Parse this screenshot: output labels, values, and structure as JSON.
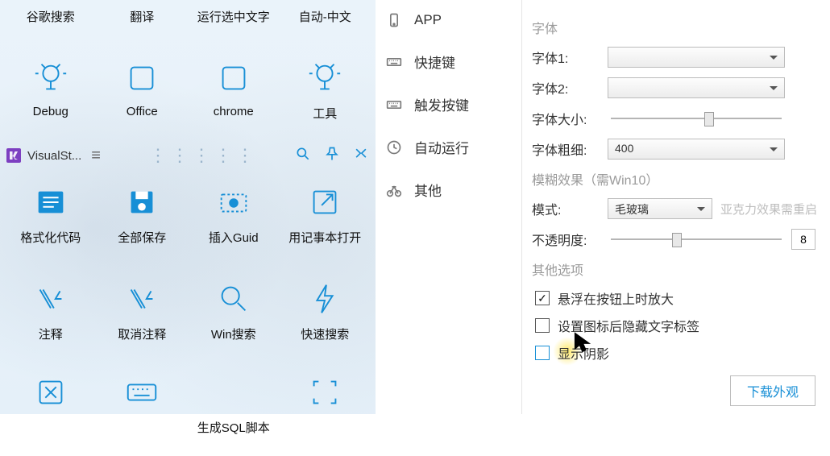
{
  "launcher": {
    "title": "VisualSt...",
    "rows": [
      {
        "type": "topLabels",
        "items": [
          "谷歌搜索",
          "翻译",
          "运行选中文字",
          "自动-中文"
        ]
      },
      {
        "items": [
          {
            "label": "Debug",
            "icon": "bulb-icon"
          },
          {
            "label": "Office",
            "icon": "square-icon"
          },
          {
            "label": "chrome",
            "icon": "square-icon"
          },
          {
            "label": "工具",
            "icon": "bulb-icon"
          }
        ]
      },
      {
        "items": [
          {
            "label": "格式化代码",
            "icon": "lines-icon"
          },
          {
            "label": "全部保存",
            "icon": "save-icon"
          },
          {
            "label": "插入Guid",
            "icon": "camera-icon"
          },
          {
            "label": "用记事本打开",
            "icon": "external-icon"
          }
        ]
      },
      {
        "items": [
          {
            "label": "注释",
            "icon": "comment-icon"
          },
          {
            "label": "取消注释",
            "icon": "uncomment-icon"
          },
          {
            "label": "Win搜索",
            "icon": "search-icon"
          },
          {
            "label": "快速搜索",
            "icon": "bolt-icon"
          }
        ]
      },
      {
        "items": [
          {
            "label": "",
            "icon": "close-box-icon"
          },
          {
            "label": "",
            "icon": "keyboard-icon"
          },
          {
            "label": "生成SQL脚本",
            "icon": ""
          },
          {
            "label": "",
            "icon": "scan-icon"
          }
        ]
      }
    ]
  },
  "sidebar": {
    "items": [
      {
        "label": "APP",
        "icon": "phone-icon"
      },
      {
        "label": "快捷键",
        "icon": "keyboard-icon"
      },
      {
        "label": "触发按键",
        "icon": "keyboard-icon"
      },
      {
        "label": "自动运行",
        "icon": "clock-icon"
      },
      {
        "label": "其他",
        "icon": "bike-icon"
      }
    ]
  },
  "form": {
    "sections": {
      "font": "字体",
      "blur": "模糊效果（需Win10）",
      "other": "其他选项"
    },
    "labels": {
      "font1": "字体1:",
      "font2": "字体2:",
      "fontSize": "字体大小:",
      "fontWeight": "字体粗细:",
      "mode": "模式:",
      "opacity": "不透明度:"
    },
    "values": {
      "fontWeight": "400",
      "mode": "毛玻璃",
      "modeHint": "亚克力效果需重启",
      "opacity": "8"
    },
    "checks": [
      {
        "label": "悬浮在按钮上时放大",
        "checked": true
      },
      {
        "label": "设置图标后隐藏文字标签",
        "checked": false
      },
      {
        "label": "显示阴影",
        "checked": false,
        "highlight": true
      }
    ],
    "downloadBtn": "下载外观"
  }
}
